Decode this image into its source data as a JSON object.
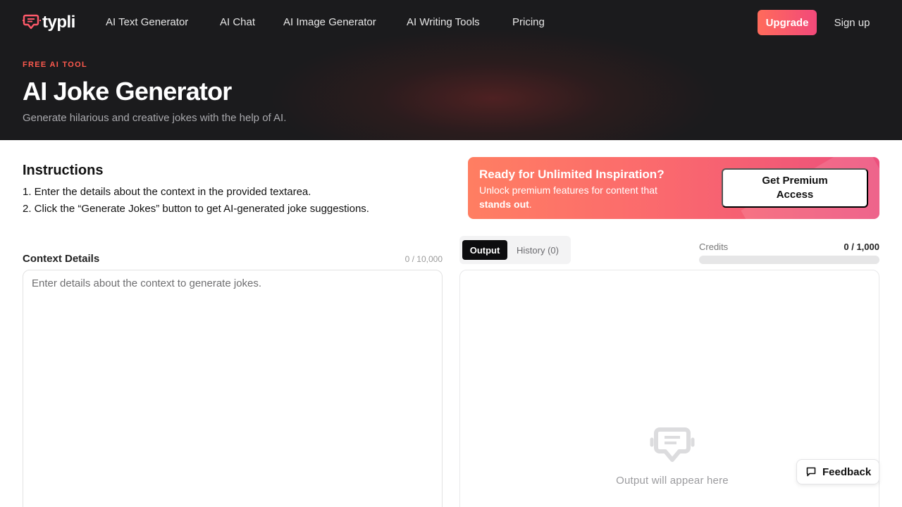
{
  "brand": {
    "name": "typli",
    "accent": "#ff5a4e",
    "gradient_start": "#ff6b5b",
    "gradient_end": "#f2497a"
  },
  "nav": {
    "items": [
      {
        "label": "AI Text Generator"
      },
      {
        "label": "AI Chat"
      },
      {
        "label": "AI Image Generator"
      },
      {
        "label": "AI Writing Tools"
      },
      {
        "label": "Pricing"
      }
    ],
    "upgrade_label": "Upgrade",
    "signup_label": "Sign up"
  },
  "hero": {
    "eyebrow": "FREE AI TOOL",
    "title": "AI Joke Generator",
    "subtitle": "Generate hilarious and creative jokes with the help of AI."
  },
  "instructions": {
    "title": "Instructions",
    "steps": [
      "1. Enter the details about the context in the provided textarea.",
      "2. Click the “Generate Jokes” button to get AI-generated joke suggestions."
    ]
  },
  "promo": {
    "title": "Ready for Unlimited Inspiration?",
    "text": "Unlock premium features for content that",
    "text_bold": "stands out",
    "text_end": ".",
    "button_label": "Get Premium Access"
  },
  "context": {
    "label": "Context Details",
    "count": "0 / 10,000",
    "value": "",
    "placeholder": "Enter details about the context to generate jokes."
  },
  "output": {
    "tabs": [
      {
        "label": "Output"
      },
      {
        "label": "History (0)"
      }
    ],
    "credits_label": "Credits",
    "credits_value": "0 / 1,000",
    "credits_used_fraction": 0,
    "empty_text": "Output will appear here",
    "empty_icon": "typli-logo-icon"
  },
  "feedback": {
    "label": "Feedback",
    "icon": "chat-bubble-icon"
  }
}
